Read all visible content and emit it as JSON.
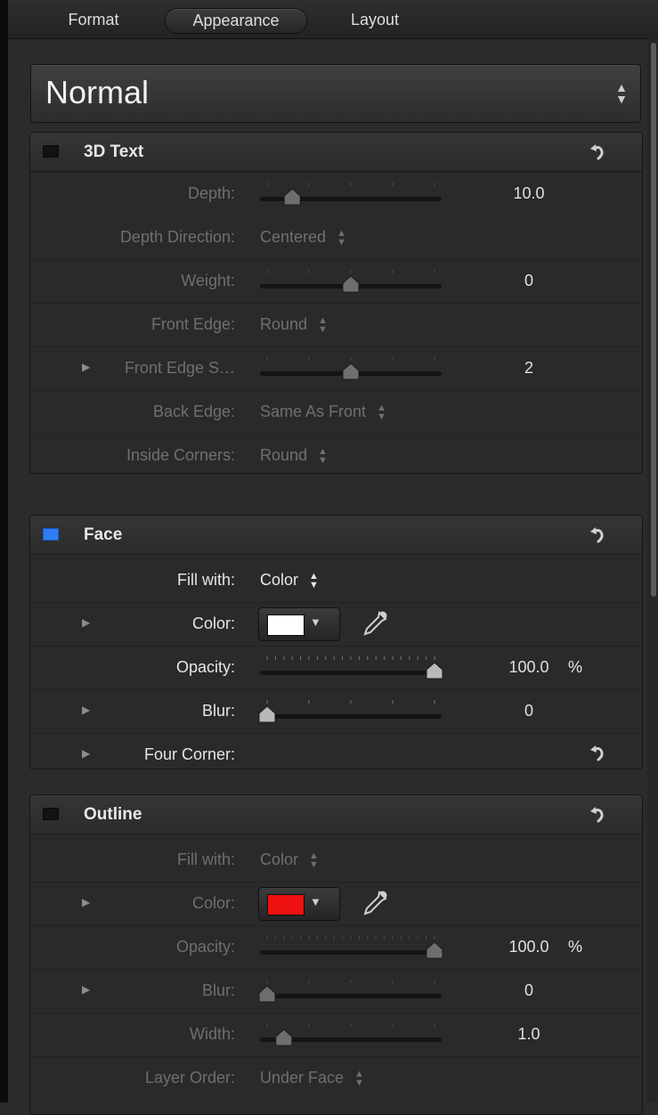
{
  "tabs": [
    {
      "label": "Format",
      "active": false
    },
    {
      "label": "Appearance",
      "active": true
    },
    {
      "label": "Layout",
      "active": false
    }
  ],
  "preset": {
    "label": "Normal"
  },
  "groups": {
    "text3d": {
      "title": "3D Text",
      "enabled": false,
      "rows": {
        "depth": {
          "label": "Depth:",
          "value": "10.0"
        },
        "depth_direction": {
          "label": "Depth Direction:",
          "value": "Centered"
        },
        "weight": {
          "label": "Weight:",
          "value": "0"
        },
        "front_edge": {
          "label": "Front Edge:",
          "value": "Round"
        },
        "front_edge_size": {
          "label": "Front Edge S…",
          "value": "2"
        },
        "back_edge": {
          "label": "Back Edge:",
          "value": "Same As Front"
        },
        "inside_corners": {
          "label": "Inside Corners:",
          "value": "Round"
        }
      }
    },
    "face": {
      "title": "Face",
      "enabled": true,
      "rows": {
        "fill_with": {
          "label": "Fill with:",
          "value": "Color"
        },
        "color": {
          "label": "Color:",
          "swatch": "#ffffff"
        },
        "opacity": {
          "label": "Opacity:",
          "value": "100.0",
          "unit": "%"
        },
        "blur": {
          "label": "Blur:",
          "value": "0"
        },
        "four_corner": {
          "label": "Four Corner:"
        }
      }
    },
    "outline": {
      "title": "Outline",
      "enabled": false,
      "rows": {
        "fill_with": {
          "label": "Fill with:",
          "value": "Color"
        },
        "color": {
          "label": "Color:",
          "swatch": "#ee1111"
        },
        "opacity": {
          "label": "Opacity:",
          "value": "100.0",
          "unit": "%"
        },
        "blur": {
          "label": "Blur:",
          "value": "0"
        },
        "width": {
          "label": "Width:",
          "value": "1.0"
        },
        "layer_order": {
          "label": "Layer Order:",
          "value": "Under Face"
        }
      }
    }
  },
  "slider_levels": {
    "depth": 0.15,
    "weight": 0.5,
    "front_edge_size": 0.5,
    "face_opacity": 1.0,
    "face_blur": 0.0,
    "outline_opacity": 1.0,
    "outline_blur": 0.0,
    "outline_width": 0.1
  },
  "icons": {
    "reset": "reset-arrow-icon",
    "disclosure": "disclosure-triangle-icon",
    "eyedropper": "eyedropper-icon",
    "popup": "up-down-arrows-icon"
  },
  "colors": {
    "accent": "#2f7df5",
    "face_color": "#ffffff",
    "outline_color": "#ee1111"
  }
}
